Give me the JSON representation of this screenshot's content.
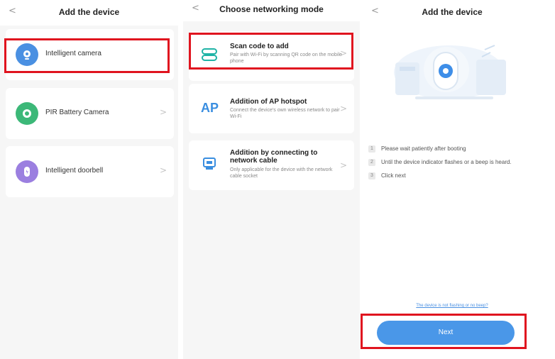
{
  "panel1": {
    "back": "<",
    "title": "Add the device",
    "devices": [
      {
        "label": "Intelligent camera",
        "icon": "camera-icon",
        "color": "#4a90e2"
      },
      {
        "label": "PIR Battery Camera",
        "icon": "battery-camera-icon",
        "color": "#3cb878"
      },
      {
        "label": "Intelligent doorbell",
        "icon": "doorbell-icon",
        "color": "#9b7fe0"
      }
    ],
    "chevron": ">"
  },
  "panel2": {
    "back": "<",
    "title": "Choose networking mode",
    "modes": [
      {
        "title": "Scan code to add",
        "desc": "Pair with Wi-Fi by scanning QR code on the mobile phone",
        "icon": "qr-scan-icon"
      },
      {
        "title": "Addition of AP hotspot",
        "desc": "Connect the device's own wireless network to pair Wi-Fi",
        "icon": "ap-hotspot-icon"
      },
      {
        "title": "Addition by connecting to network cable",
        "desc": "Only applicable for the device with the network cable socket",
        "icon": "ethernet-icon"
      }
    ],
    "chevron": ">"
  },
  "panel3": {
    "back": "<",
    "title": "Add the device",
    "steps": [
      {
        "num": "1",
        "text": "Please wait patiently after booting"
      },
      {
        "num": "2",
        "text": "Until the device indicator flashes or a beep is heard."
      },
      {
        "num": "3",
        "text": "Click next"
      }
    ],
    "link": "The device is not flashing or no beep?",
    "next_label": "Next"
  },
  "colors": {
    "highlight": "#e0141f",
    "accent": "#4a97e8"
  }
}
